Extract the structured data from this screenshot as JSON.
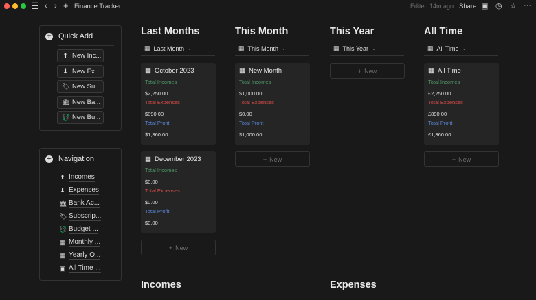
{
  "topbar": {
    "title": "Finance Tracker",
    "edited": "Edited 14m ago",
    "share": "Share"
  },
  "quick_add": {
    "title": "Quick Add",
    "buttons": [
      {
        "label": "New Inc...",
        "icon": "arrow-up-circle-icon"
      },
      {
        "label": "New Ex...",
        "icon": "arrow-down-circle-icon"
      },
      {
        "label": "New Su...",
        "icon": "tag-icon"
      },
      {
        "label": "New Ba...",
        "icon": "bank-icon"
      },
      {
        "label": "New Bu...",
        "icon": "budget-icon"
      }
    ]
  },
  "navigation": {
    "title": "Navigation",
    "items": [
      {
        "label": "Incomes"
      },
      {
        "label": "Expenses"
      },
      {
        "label": "Bank Ac..."
      },
      {
        "label": "Subscrip..."
      },
      {
        "label": "Budget ..."
      },
      {
        "label": "Monthly ..."
      },
      {
        "label": "Yearly O..."
      },
      {
        "label": "All Time ..."
      }
    ]
  },
  "columns": [
    {
      "title": "Last Months",
      "view": "Last Month",
      "cards": [
        {
          "title": "October 2023",
          "income_label": "Total Incomes",
          "income": "$2,250.00",
          "expense_label": "Total Expenses",
          "expense": "$890.00",
          "profit_label": "Total Profit",
          "profit": "$1,360.00"
        },
        {
          "title": "December 2023",
          "income_label": "Total Incomes",
          "income": "$0.00",
          "expense_label": "Total Expenses",
          "expense": "$0.00",
          "profit_label": "Total Profit",
          "profit": "$0.00"
        }
      ]
    },
    {
      "title": "This Month",
      "view": "This Month",
      "cards": [
        {
          "title": "New Month",
          "income_label": "Total Incomes",
          "income": "$1,000.00",
          "expense_label": "Total Expenses",
          "expense": "$0.00",
          "profit_label": "Total Profit",
          "profit": "$1,000.00"
        }
      ]
    },
    {
      "title": "This Year",
      "view": "This Year",
      "cards": []
    },
    {
      "title": "All Time",
      "view": "All Time",
      "cards": [
        {
          "title": "All Time",
          "income_label": "Total Incomes",
          "income": "£2,250.00",
          "expense_label": "Total Expenses",
          "expense": "£890.00",
          "profit_label": "Total Profit",
          "profit": "£1,360.00"
        }
      ]
    }
  ],
  "new_label": "New",
  "sections": {
    "incomes": "Incomes",
    "expenses": "Expenses"
  }
}
